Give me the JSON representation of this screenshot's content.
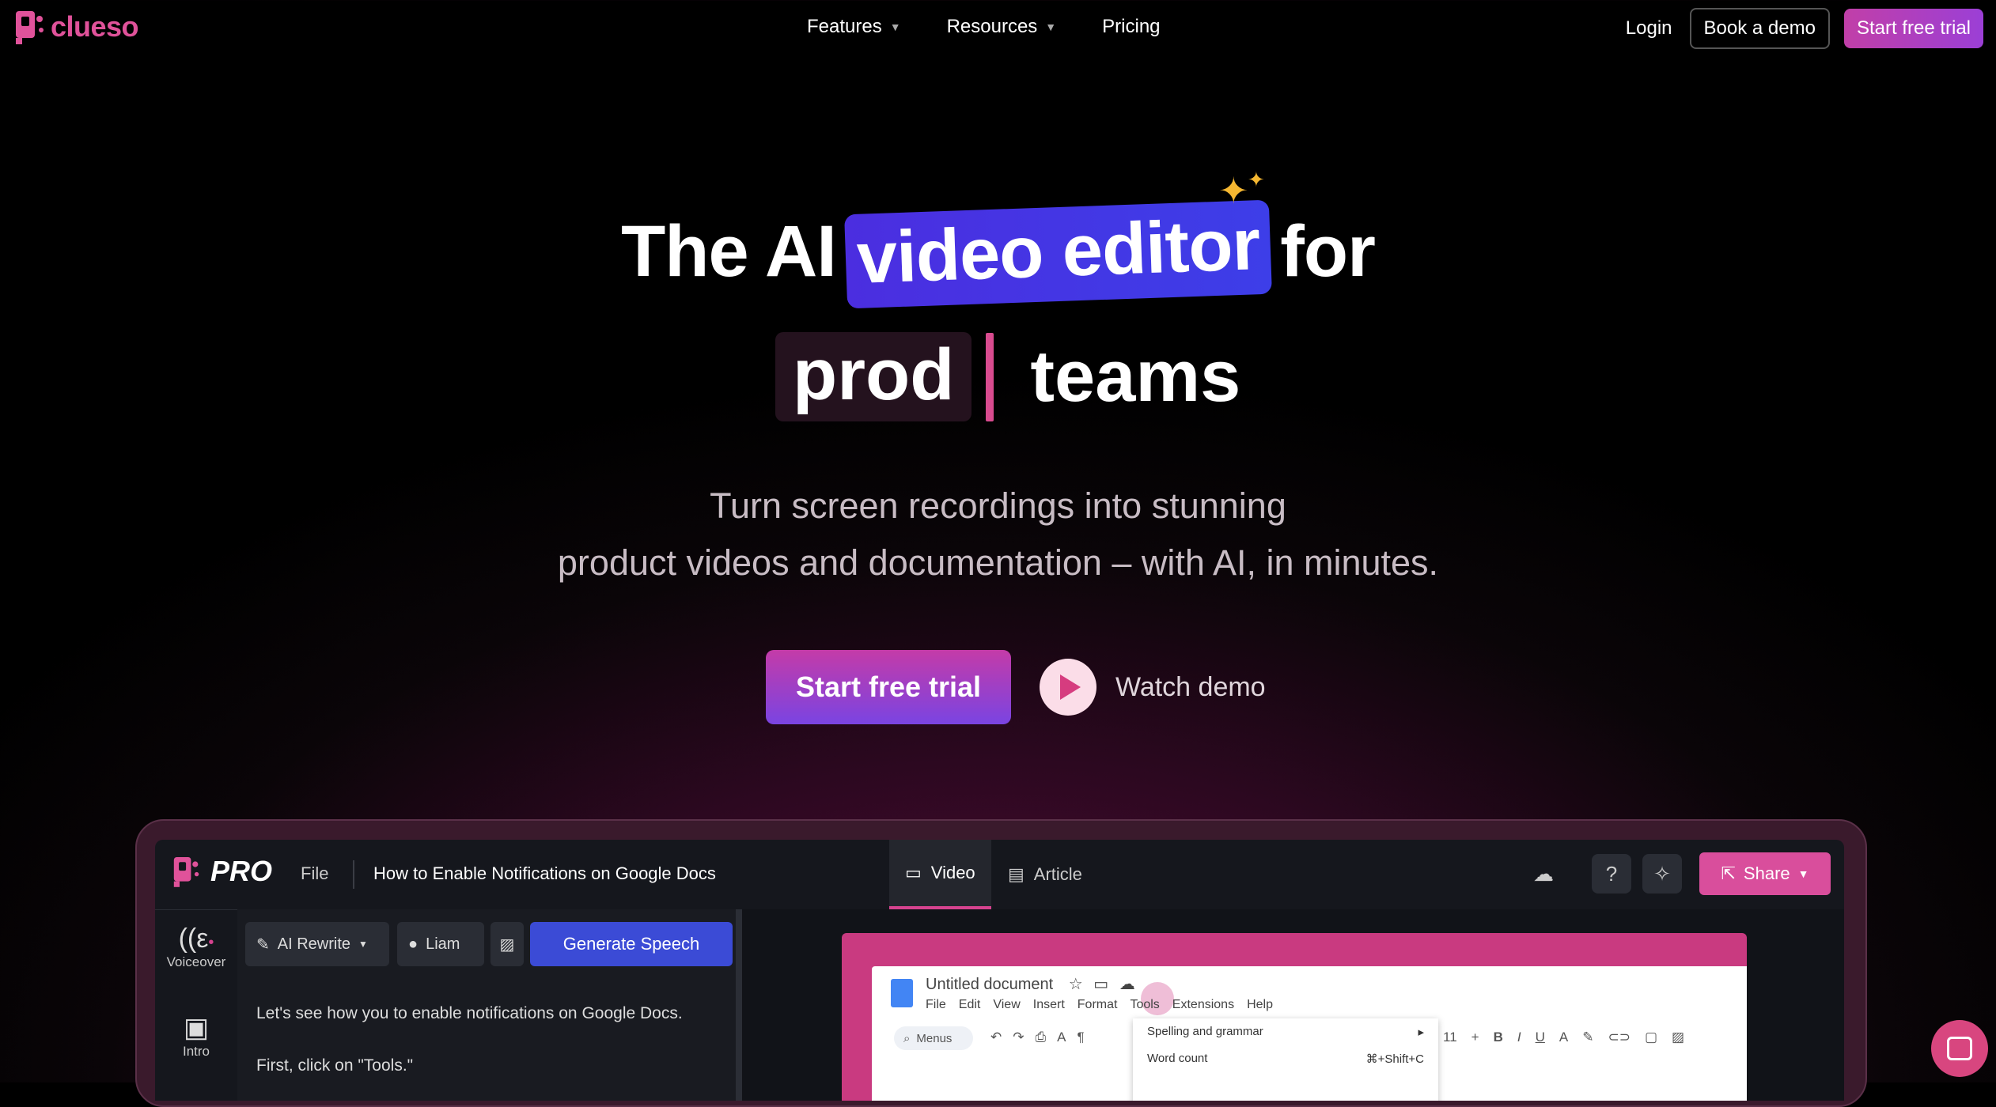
{
  "brand": {
    "name": "clueso",
    "accent": "#e0529a"
  },
  "nav": {
    "items": [
      {
        "label": "Features",
        "has_dropdown": true
      },
      {
        "label": "Resources",
        "has_dropdown": true
      },
      {
        "label": "Pricing",
        "has_dropdown": false
      }
    ],
    "login": "Login",
    "book_demo": "Book a demo",
    "start_trial": "Start free trial"
  },
  "hero": {
    "headline_pre": "The AI",
    "headline_highlight": "video editor",
    "headline_post": "for",
    "typed_word": "prod",
    "headline_end": "teams",
    "subtitle_line1": "Turn screen recordings into stunning",
    "subtitle_line2": "product videos and documentation – with AI, in minutes.",
    "cta_primary": "Start free trial",
    "cta_secondary": "Watch demo"
  },
  "app": {
    "pro_label": "PRO",
    "file_menu": "File",
    "document_title": "How to Enable Notifications on Google Docs",
    "tabs": [
      {
        "label": "Video",
        "active": true
      },
      {
        "label": "Article",
        "active": false
      }
    ],
    "share_label": "Share",
    "rail": [
      {
        "label": "Voiceover"
      },
      {
        "label": "Intro"
      }
    ],
    "toolbar": {
      "ai_rewrite": "AI Rewrite",
      "voice": "Liam",
      "generate": "Generate Speech"
    },
    "script_lines": [
      "Let's see how you to enable notifications on Google Docs.",
      "First, click on \"Tools.\""
    ],
    "gdoc": {
      "title": "Untitled document",
      "menu": [
        "File",
        "Edit",
        "View",
        "Insert",
        "Format",
        "Tools",
        "Extensions",
        "Help"
      ],
      "search": "Menus",
      "font_size": "11",
      "dropdown": [
        {
          "label": "Spelling and grammar",
          "shortcut": "▸"
        },
        {
          "label": "Word count",
          "shortcut": "⌘+Shift+C"
        }
      ]
    }
  }
}
